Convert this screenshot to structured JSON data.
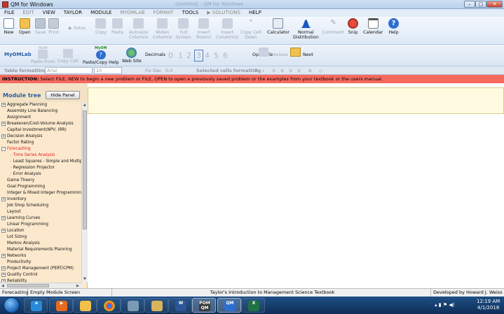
{
  "window": {
    "title": "QM for Windows",
    "ghost_title": "(Untitled) - QM for Windows",
    "min": "–",
    "max": "□",
    "close": "✕"
  },
  "menu": [
    "FILE",
    "EDIT",
    "VIEW",
    "TAYLOR",
    "MODULE",
    "MYOMLAB",
    "FORMAT",
    "TOOLS",
    "▶ SOLUTIONS",
    "HELP"
  ],
  "toolbar": {
    "new": "New",
    "open": "Open",
    "save": "Save",
    "print": "Print",
    "solve": "Solve",
    "copy": "Copy",
    "paste": "Paste",
    "autosize_1": "Autosize",
    "autosize_2": "Columns",
    "widen_1": "Widen",
    "widen_2": "Columns",
    "full_1": "Full",
    "full_2": "Screen",
    "insert_row_1": "Insert",
    "insert_row_2": "Row(s)",
    "insert_col_1": "Insert",
    "insert_col_2": "Column(s)",
    "copy_cell_1": "Copy Cell",
    "copy_cell_2": "Down",
    "calculator": "Calculator",
    "normal_1": "Normal",
    "normal_2": "Distribution",
    "comment": "Comment",
    "snip": "Snip",
    "calendar": "Calendar",
    "help": "Help"
  },
  "toolbar2": {
    "myomlab": "MyOMLab",
    "myomlab_small": "MyOM",
    "paste_from": "Paste From",
    "copy_cell": "Copy Cell",
    "paste_copy_help": "Paste/Copy Help",
    "myom_help": "MyOM",
    "web_site": "Web Site",
    "decimals": "Decimals",
    "digits": [
      "0",
      "1",
      "2",
      "3",
      "4",
      "5",
      "6"
    ],
    "open_file": "Open File",
    "previous": "Previous",
    "next": "Next"
  },
  "formatbar": {
    "label": "Table formatting",
    "font": "Arial",
    "size": "10",
    "fix_dec": "Fix Dec",
    "fix_val": "0.0",
    "selected_label": "Selected cells formatting",
    "bold": "B",
    "italic": "I"
  },
  "instruction": {
    "label": "INSTRUCTION:",
    "text": "Select FILE, NEW to begin a new problem or FILE, OPEN to open a previously saved problem or the examples from your textbook or the users manual."
  },
  "module_tree": {
    "title": "Module tree",
    "hide_button": "Hide Panel",
    "items": [
      {
        "label": "Aggregate Planning",
        "exp": "+"
      },
      {
        "label": "Assembly Line Balancing",
        "exp": ""
      },
      {
        "label": "Assignment",
        "exp": ""
      },
      {
        "label": "Breakeven/Cost-Volume Analysis",
        "exp": "+"
      },
      {
        "label": "Capital Investment(NPV, IRR)",
        "exp": ""
      },
      {
        "label": "Decision Analysis",
        "exp": "+"
      },
      {
        "label": "Factor Rating",
        "exp": ""
      },
      {
        "label": "Forecasting",
        "exp": "-",
        "red": true
      },
      {
        "label": "Time Series Analysis",
        "child": true,
        "red": true
      },
      {
        "label": "Least Squares - Simple and Multip",
        "child": true
      },
      {
        "label": "Regression Projector",
        "child": true
      },
      {
        "label": "Error Analysis",
        "child": true
      },
      {
        "label": "Game Theory",
        "exp": ""
      },
      {
        "label": "Goal Programming",
        "exp": ""
      },
      {
        "label": "Integer & Mixed Integer Programming",
        "exp": ""
      },
      {
        "label": "Inventory",
        "exp": "+"
      },
      {
        "label": "Job Shop Scheduling",
        "exp": ""
      },
      {
        "label": "Layout",
        "exp": ""
      },
      {
        "label": "Learning Curves",
        "exp": "+"
      },
      {
        "label": "Linear Programming",
        "exp": ""
      },
      {
        "label": "Location",
        "exp": "+"
      },
      {
        "label": "Lot Sizing",
        "exp": ""
      },
      {
        "label": "Markov Analysis",
        "exp": ""
      },
      {
        "label": "Material Requirements Planning",
        "exp": ""
      },
      {
        "label": "Networks",
        "exp": "+"
      },
      {
        "label": "Productivity",
        "exp": ""
      },
      {
        "label": "Project Management (PERT/CPM)",
        "exp": "+"
      },
      {
        "label": "Quality Control",
        "exp": "+"
      },
      {
        "label": "Reliability",
        "exp": "+"
      }
    ]
  },
  "status": {
    "module": "Forecasting",
    "screen": "Empty Module Screen",
    "book": "Taylor's Introduction to Management Science Textbook",
    "developer": "Developed by Howard J. Weiss"
  },
  "taskbar": {
    "qm_label": "POM QM",
    "time": "12:19 AM",
    "date": "4/1/2018"
  },
  "colors": {
    "instruction_bg": "#f76a5e",
    "tree_bg": "#fce9cd",
    "yellow_box": "#fffbe0",
    "accent_blue": "#2c5fa8"
  }
}
